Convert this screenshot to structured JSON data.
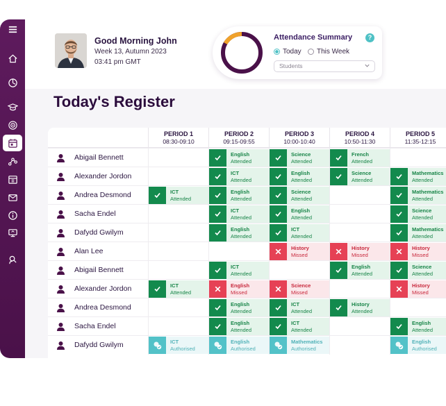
{
  "header": {
    "greeting": "Good Morning John",
    "week": "Week 13, Autumn 2023",
    "time": "03:41 pm GMT"
  },
  "summary": {
    "title": "Attendance Summary",
    "help": "?",
    "options": [
      "Today",
      "This Week"
    ],
    "selected_option": "Today",
    "dropdown_value": "Students",
    "colors": {
      "ring_track": "#4a1149",
      "ring_highlight": "#f0a22b"
    }
  },
  "page_title": "Today's Register",
  "periods": [
    {
      "name": "PERIOD 1",
      "time": "08:30-09:10"
    },
    {
      "name": "PERIOD 2",
      "time": "09:15-09:55"
    },
    {
      "name": "PERIOD 3",
      "time": "10:00-10:40"
    },
    {
      "name": "PERIOD 4",
      "time": "10:50-11:30"
    },
    {
      "name": "PERIOD 5",
      "time": "11:35-12:15"
    }
  ],
  "pupils": [
    {
      "name": "Abigail Bennett",
      "cells": [
        null,
        {
          "subject": "English",
          "status": "Attended"
        },
        {
          "subject": "Science",
          "status": "Attended"
        },
        {
          "subject": "French",
          "status": "Attended"
        },
        null
      ]
    },
    {
      "name": "Alexander Jordon",
      "cells": [
        null,
        {
          "subject": "ICT",
          "status": "Attended"
        },
        {
          "subject": "English",
          "status": "Attended"
        },
        {
          "subject": "Science",
          "status": "Attended"
        },
        {
          "subject": "Mathematics",
          "status": "Attended"
        }
      ]
    },
    {
      "name": "Andrea Desmond",
      "cells": [
        {
          "subject": "ICT",
          "status": "Attended"
        },
        {
          "subject": "English",
          "status": "Attended"
        },
        {
          "subject": "Science",
          "status": "Attended"
        },
        null,
        {
          "subject": "Mathematics",
          "status": "Attended"
        }
      ]
    },
    {
      "name": "Sacha Endel",
      "cells": [
        null,
        {
          "subject": "ICT",
          "status": "Attended"
        },
        {
          "subject": "English",
          "status": "Attended"
        },
        null,
        {
          "subject": "Science",
          "status": "Attended"
        }
      ]
    },
    {
      "name": "Dafydd Gwilym",
      "cells": [
        null,
        {
          "subject": "English",
          "status": "Attended"
        },
        {
          "subject": "ICT",
          "status": "Attended"
        },
        null,
        {
          "subject": "Mathematics",
          "status": "Attended"
        }
      ]
    },
    {
      "name": "Alan Lee",
      "cells": [
        null,
        null,
        {
          "subject": "History",
          "status": "Missed"
        },
        {
          "subject": "History",
          "status": "Missed"
        },
        {
          "subject": "History",
          "status": "Missed"
        }
      ]
    },
    {
      "name": "Abigail Bennett",
      "cells": [
        null,
        {
          "subject": "ICT",
          "status": "Attended"
        },
        null,
        {
          "subject": "English",
          "status": "Attended"
        },
        {
          "subject": "Science",
          "status": "Attended"
        }
      ]
    },
    {
      "name": "Alexander Jordon",
      "cells": [
        {
          "subject": "ICT",
          "status": "Attended"
        },
        {
          "subject": "English",
          "status": "Missed"
        },
        {
          "subject": "Science",
          "status": "Missed"
        },
        null,
        {
          "subject": "History",
          "status": "Missed"
        }
      ]
    },
    {
      "name": "Andrea Desmond",
      "cells": [
        null,
        {
          "subject": "English",
          "status": "Attended"
        },
        {
          "subject": "ICT",
          "status": "Attended"
        },
        {
          "subject": "History",
          "status": "Attended"
        },
        null
      ]
    },
    {
      "name": "Sacha Endel",
      "cells": [
        null,
        {
          "subject": "English",
          "status": "Attended"
        },
        {
          "subject": "ICT",
          "status": "Attended"
        },
        null,
        {
          "subject": "English",
          "status": "Attended"
        }
      ]
    },
    {
      "name": "Dafydd Gwilym",
      "cells": [
        {
          "subject": "ICT",
          "status": "Authorised"
        },
        {
          "subject": "English",
          "status": "Authorised"
        },
        {
          "subject": "Mathematics",
          "status": "Authorised"
        },
        null,
        {
          "subject": "English",
          "status": "Authorised"
        }
      ]
    }
  ],
  "sidebar_icons": [
    "menu-icon",
    "home-icon",
    "dashboard-icon",
    "graduation-cap-icon",
    "target-icon",
    "calendar-icon",
    "network-icon",
    "timetable-icon",
    "mail-icon",
    "info-icon",
    "monitor-icon",
    "user-search-icon"
  ],
  "sidebar_active": "calendar-icon"
}
